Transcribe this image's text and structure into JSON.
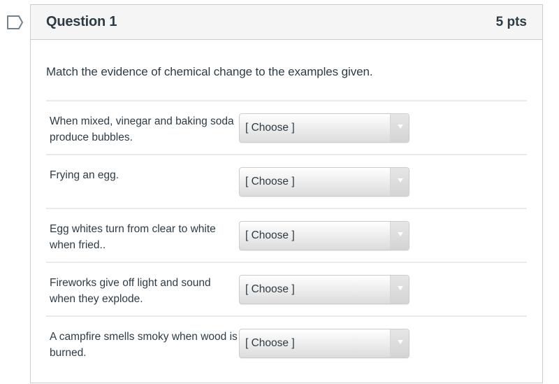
{
  "question": {
    "title": "Question 1",
    "points": "5 pts",
    "prompt": "Match the evidence of chemical change to the examples given.",
    "flag_icon": "bookmark-flag-icon",
    "matches": [
      {
        "label": "When mixed, vinegar and baking soda produce bubbles.",
        "selected": "[ Choose ]"
      },
      {
        "label": "Frying an egg.",
        "selected": "[ Choose ]"
      },
      {
        "label": "Egg whites turn from clear to white when fried..",
        "selected": "[ Choose ]"
      },
      {
        "label": "Fireworks give off light and sound when they explode.",
        "selected": "[ Choose ]"
      },
      {
        "label": "A campfire smells smoky when wood is burned.",
        "selected": "[ Choose ]"
      }
    ]
  },
  "colors": {
    "text": "#2d3b45",
    "border": "#c7cdd1",
    "header_bg": "#f5f5f5",
    "divider": "#e8eaec"
  }
}
